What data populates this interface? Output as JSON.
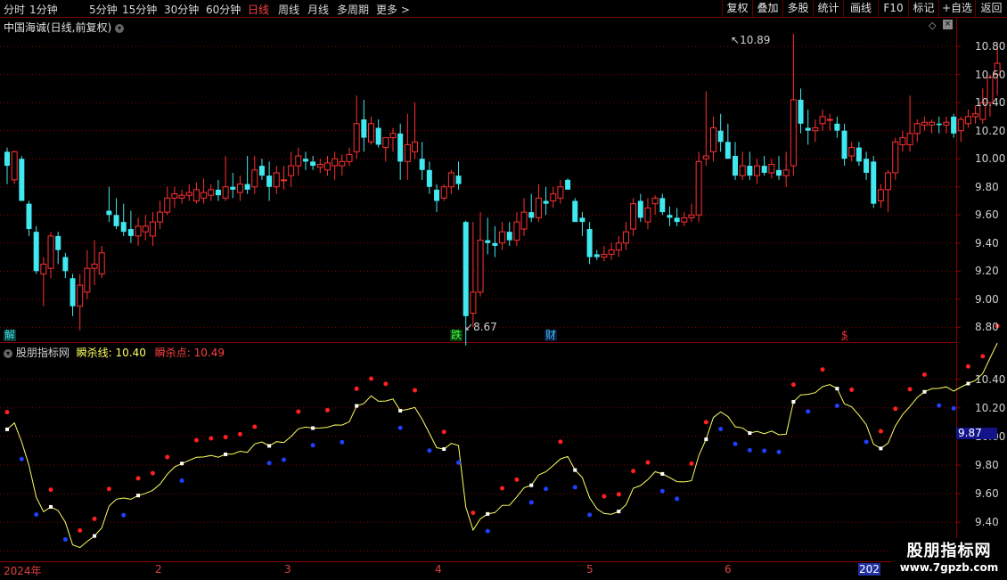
{
  "toolbar": {
    "periods": [
      "分时",
      "1分钟",
      "5分钟",
      "15分钟",
      "30分钟",
      "60分钟",
      "日线",
      "周线",
      "月线",
      "多周期",
      "更多 >"
    ],
    "active_period": "日线",
    "right_buttons": [
      "复权",
      "叠加",
      "多股",
      "统计",
      "画线",
      "F10",
      "标记",
      "+自选",
      "返回"
    ]
  },
  "stock": {
    "title": "中国海诚(日线,前复权)"
  },
  "main_axis": {
    "ticks": [
      "10.80",
      "10.60",
      "10.40",
      "10.20",
      "10.00",
      "9.80",
      "9.60",
      "9.40",
      "9.20",
      "9.00",
      "8.80"
    ],
    "ymin": 8.72,
    "ymax": 10.94
  },
  "annotations": {
    "high": "10.89",
    "low": "8.67"
  },
  "markers": [
    {
      "text": "解",
      "color": "#40e0e0",
      "bg": "#0a3a3a"
    },
    {
      "text": "跌",
      "color": "#40ff40",
      "bg": "#0a3a0a"
    },
    {
      "text": "财",
      "color": "#40c0ff",
      "bg": "#0a1a3a"
    },
    {
      "text": "$",
      "color": "#ff3030",
      "bg": "#000000"
    }
  ],
  "indicator": {
    "name": "股朋指标网",
    "line_label": "瞬杀线:",
    "line_value": "10.40",
    "point_label": "瞬杀点:",
    "point_value": "10.49",
    "ticks": [
      "10.40",
      "10.20",
      "10.00",
      "9.80",
      "9.60",
      "9.40",
      "9.20"
    ],
    "current": "9.87",
    "ymin": 9.14,
    "ymax": 10.56
  },
  "dates": [
    "2024年",
    "2",
    "3",
    "4",
    "5",
    "6",
    "202"
  ],
  "watermark": {
    "line1": "股朋指标网",
    "line2": "www.7gpzb.com"
  },
  "colors": {
    "up": "#ff3030",
    "down": "#40e8f0",
    "grid": "#8a0000",
    "line": "#ffff60",
    "red_dot": "#ff2020",
    "blue_dot": "#2040ff"
  },
  "chart_data": {
    "type": "candlestick",
    "series": [
      {
        "o": 10.05,
        "h": 10.08,
        "l": 9.82,
        "c": 9.95
      },
      {
        "o": 9.85,
        "h": 10.06,
        "l": 9.82,
        "c": 10.05
      },
      {
        "o": 10.0,
        "h": 10.02,
        "l": 9.75,
        "c": 9.7
      },
      {
        "o": 9.68,
        "h": 9.7,
        "l": 9.45,
        "c": 9.5
      },
      {
        "o": 9.48,
        "h": 9.52,
        "l": 9.18,
        "c": 9.2
      },
      {
        "o": 9.18,
        "h": 9.3,
        "l": 8.95,
        "c": 9.25
      },
      {
        "o": 9.22,
        "h": 9.48,
        "l": 9.15,
        "c": 9.45
      },
      {
        "o": 9.45,
        "h": 9.48,
        "l": 9.25,
        "c": 9.35
      },
      {
        "o": 9.3,
        "h": 9.33,
        "l": 9.15,
        "c": 9.2
      },
      {
        "o": 9.15,
        "h": 9.18,
        "l": 8.88,
        "c": 8.95
      },
      {
        "o": 8.95,
        "h": 9.18,
        "l": 8.78,
        "c": 9.1
      },
      {
        "o": 9.05,
        "h": 9.35,
        "l": 9.0,
        "c": 9.22
      },
      {
        "o": 9.22,
        "h": 9.42,
        "l": 9.1,
        "c": 9.25
      },
      {
        "o": 9.18,
        "h": 9.38,
        "l": 9.15,
        "c": 9.33
      },
      {
        "o": 9.63,
        "h": 9.8,
        "l": 9.55,
        "c": 9.6
      },
      {
        "o": 9.6,
        "h": 9.72,
        "l": 9.5,
        "c": 9.52
      },
      {
        "o": 9.55,
        "h": 9.68,
        "l": 9.45,
        "c": 9.48
      },
      {
        "o": 9.5,
        "h": 9.63,
        "l": 9.4,
        "c": 9.45
      },
      {
        "o": 9.45,
        "h": 9.58,
        "l": 9.38,
        "c": 9.52
      },
      {
        "o": 9.48,
        "h": 9.6,
        "l": 9.42,
        "c": 9.52
      },
      {
        "o": 9.45,
        "h": 9.62,
        "l": 9.38,
        "c": 9.55
      },
      {
        "o": 9.55,
        "h": 9.7,
        "l": 9.5,
        "c": 9.62
      },
      {
        "o": 9.62,
        "h": 9.8,
        "l": 9.6,
        "c": 9.72
      },
      {
        "o": 9.72,
        "h": 9.8,
        "l": 9.65,
        "c": 9.75
      },
      {
        "o": 9.72,
        "h": 9.78,
        "l": 9.68,
        "c": 9.74
      },
      {
        "o": 9.74,
        "h": 9.82,
        "l": 9.7,
        "c": 9.76
      },
      {
        "o": 9.7,
        "h": 9.83,
        "l": 9.68,
        "c": 9.78
      },
      {
        "o": 9.72,
        "h": 9.86,
        "l": 9.68,
        "c": 9.76
      },
      {
        "o": 9.74,
        "h": 9.82,
        "l": 9.7,
        "c": 9.78
      },
      {
        "o": 9.78,
        "h": 9.85,
        "l": 9.7,
        "c": 9.74
      },
      {
        "o": 9.72,
        "h": 10.02,
        "l": 9.7,
        "c": 9.8
      },
      {
        "o": 9.8,
        "h": 9.9,
        "l": 9.72,
        "c": 9.78
      },
      {
        "o": 9.76,
        "h": 9.88,
        "l": 9.7,
        "c": 9.82
      },
      {
        "o": 9.82,
        "h": 10.02,
        "l": 9.75,
        "c": 9.78
      },
      {
        "o": 9.8,
        "h": 10.02,
        "l": 9.75,
        "c": 9.92
      },
      {
        "o": 9.95,
        "h": 10.0,
        "l": 9.85,
        "c": 9.88
      },
      {
        "o": 9.88,
        "h": 9.98,
        "l": 9.7,
        "c": 9.8
      },
      {
        "o": 9.8,
        "h": 9.95,
        "l": 9.75,
        "c": 9.9
      },
      {
        "o": 9.85,
        "h": 9.95,
        "l": 9.78,
        "c": 9.85
      },
      {
        "o": 9.88,
        "h": 10.05,
        "l": 9.8,
        "c": 9.95
      },
      {
        "o": 9.95,
        "h": 10.08,
        "l": 9.88,
        "c": 10.02
      },
      {
        "o": 10.0,
        "h": 10.05,
        "l": 9.92,
        "c": 9.98
      },
      {
        "o": 9.98,
        "h": 10.02,
        "l": 9.92,
        "c": 9.95
      },
      {
        "o": 9.94,
        "h": 10.0,
        "l": 9.9,
        "c": 9.96
      },
      {
        "o": 9.92,
        "h": 10.02,
        "l": 9.88,
        "c": 9.97
      },
      {
        "o": 9.95,
        "h": 10.05,
        "l": 9.85,
        "c": 10.0
      },
      {
        "o": 9.95,
        "h": 10.03,
        "l": 9.88,
        "c": 9.98
      },
      {
        "o": 9.98,
        "h": 10.08,
        "l": 9.95,
        "c": 10.03
      },
      {
        "o": 10.05,
        "h": 10.45,
        "l": 10.0,
        "c": 10.25
      },
      {
        "o": 10.28,
        "h": 10.42,
        "l": 10.05,
        "c": 10.15
      },
      {
        "o": 10.12,
        "h": 10.3,
        "l": 10.1,
        "c": 10.25
      },
      {
        "o": 10.22,
        "h": 10.28,
        "l": 10.08,
        "c": 10.1
      },
      {
        "o": 10.08,
        "h": 10.12,
        "l": 9.98,
        "c": 10.15
      },
      {
        "o": 10.15,
        "h": 10.22,
        "l": 10.05,
        "c": 10.18
      },
      {
        "o": 10.18,
        "h": 10.25,
        "l": 9.85,
        "c": 9.98
      },
      {
        "o": 9.98,
        "h": 10.32,
        "l": 9.85,
        "c": 10.1
      },
      {
        "o": 10.05,
        "h": 10.4,
        "l": 10.0,
        "c": 10.12
      },
      {
        "o": 10.0,
        "h": 10.12,
        "l": 9.85,
        "c": 9.92
      },
      {
        "o": 9.92,
        "h": 9.98,
        "l": 9.75,
        "c": 9.8
      },
      {
        "o": 9.78,
        "h": 9.82,
        "l": 9.62,
        "c": 9.7
      },
      {
        "o": 9.72,
        "h": 9.82,
        "l": 9.7,
        "c": 9.8
      },
      {
        "o": 9.8,
        "h": 9.92,
        "l": 9.75,
        "c": 9.9
      },
      {
        "o": 9.88,
        "h": 9.98,
        "l": 9.78,
        "c": 9.82
      },
      {
        "o": 9.55,
        "h": 9.56,
        "l": 8.67,
        "c": 8.88
      },
      {
        "o": 8.9,
        "h": 9.55,
        "l": 8.8,
        "c": 9.05
      },
      {
        "o": 9.05,
        "h": 9.62,
        "l": 9.02,
        "c": 9.42
      },
      {
        "o": 9.42,
        "h": 9.58,
        "l": 9.32,
        "c": 9.4
      },
      {
        "o": 9.4,
        "h": 9.52,
        "l": 9.3,
        "c": 9.38
      },
      {
        "o": 9.4,
        "h": 9.55,
        "l": 9.35,
        "c": 9.48
      },
      {
        "o": 9.48,
        "h": 9.55,
        "l": 9.38,
        "c": 9.42
      },
      {
        "o": 9.42,
        "h": 9.62,
        "l": 9.38,
        "c": 9.55
      },
      {
        "o": 9.5,
        "h": 9.72,
        "l": 9.45,
        "c": 9.62
      },
      {
        "o": 9.62,
        "h": 9.75,
        "l": 9.55,
        "c": 9.58
      },
      {
        "o": 9.58,
        "h": 9.82,
        "l": 9.55,
        "c": 9.72
      },
      {
        "o": 9.7,
        "h": 9.8,
        "l": 9.6,
        "c": 9.68
      },
      {
        "o": 9.7,
        "h": 9.8,
        "l": 9.65,
        "c": 9.75
      },
      {
        "o": 9.72,
        "h": 9.85,
        "l": 9.68,
        "c": 9.8
      },
      {
        "o": 9.85,
        "h": 9.86,
        "l": 9.78,
        "c": 9.78
      },
      {
        "o": 9.7,
        "h": 9.72,
        "l": 9.55,
        "c": 9.55
      },
      {
        "o": 9.58,
        "h": 9.62,
        "l": 9.45,
        "c": 9.55
      },
      {
        "o": 9.5,
        "h": 9.55,
        "l": 9.25,
        "c": 9.3
      },
      {
        "o": 9.32,
        "h": 9.35,
        "l": 9.28,
        "c": 9.3
      },
      {
        "o": 9.3,
        "h": 9.38,
        "l": 9.27,
        "c": 9.32
      },
      {
        "o": 9.32,
        "h": 9.4,
        "l": 9.28,
        "c": 9.35
      },
      {
        "o": 9.35,
        "h": 9.45,
        "l": 9.3,
        "c": 9.4
      },
      {
        "o": 9.4,
        "h": 9.55,
        "l": 9.35,
        "c": 9.48
      },
      {
        "o": 9.5,
        "h": 9.72,
        "l": 9.45,
        "c": 9.68
      },
      {
        "o": 9.7,
        "h": 9.75,
        "l": 9.55,
        "c": 9.58
      },
      {
        "o": 9.55,
        "h": 9.72,
        "l": 9.5,
        "c": 9.65
      },
      {
        "o": 9.68,
        "h": 9.74,
        "l": 9.6,
        "c": 9.72
      },
      {
        "o": 9.72,
        "h": 9.75,
        "l": 9.6,
        "c": 9.62
      },
      {
        "o": 9.6,
        "h": 9.66,
        "l": 9.52,
        "c": 9.58
      },
      {
        "o": 9.58,
        "h": 9.65,
        "l": 9.52,
        "c": 9.55
      },
      {
        "o": 9.55,
        "h": 9.62,
        "l": 9.52,
        "c": 9.58
      },
      {
        "o": 9.58,
        "h": 9.68,
        "l": 9.55,
        "c": 9.6
      },
      {
        "o": 9.6,
        "h": 10.05,
        "l": 9.55,
        "c": 9.98
      },
      {
        "o": 10.0,
        "h": 10.48,
        "l": 9.95,
        "c": 10.02
      },
      {
        "o": 10.05,
        "h": 10.3,
        "l": 9.98,
        "c": 10.22
      },
      {
        "o": 10.2,
        "h": 10.32,
        "l": 10.05,
        "c": 10.12
      },
      {
        "o": 10.12,
        "h": 10.25,
        "l": 10.0,
        "c": 10.0
      },
      {
        "o": 10.02,
        "h": 10.12,
        "l": 9.85,
        "c": 9.88
      },
      {
        "o": 9.88,
        "h": 10.05,
        "l": 9.85,
        "c": 9.95
      },
      {
        "o": 9.95,
        "h": 10.05,
        "l": 9.85,
        "c": 9.88
      },
      {
        "o": 9.88,
        "h": 10.0,
        "l": 9.82,
        "c": 9.95
      },
      {
        "o": 9.95,
        "h": 10.02,
        "l": 9.88,
        "c": 9.9
      },
      {
        "o": 9.9,
        "h": 10.0,
        "l": 9.86,
        "c": 9.96
      },
      {
        "o": 9.92,
        "h": 10.02,
        "l": 9.85,
        "c": 9.88
      },
      {
        "o": 9.88,
        "h": 10.05,
        "l": 9.8,
        "c": 9.92
      },
      {
        "o": 9.95,
        "h": 10.89,
        "l": 9.88,
        "c": 10.42
      },
      {
        "o": 10.42,
        "h": 10.5,
        "l": 10.18,
        "c": 10.25
      },
      {
        "o": 10.22,
        "h": 10.35,
        "l": 10.1,
        "c": 10.2
      },
      {
        "o": 10.2,
        "h": 10.28,
        "l": 10.12,
        "c": 10.22
      },
      {
        "o": 10.25,
        "h": 10.35,
        "l": 10.2,
        "c": 10.3
      },
      {
        "o": 10.28,
        "h": 10.32,
        "l": 10.2,
        "c": 10.28
      },
      {
        "o": 10.25,
        "h": 10.3,
        "l": 10.15,
        "c": 10.2
      },
      {
        "o": 10.2,
        "h": 10.25,
        "l": 9.95,
        "c": 10.0
      },
      {
        "o": 10.02,
        "h": 10.12,
        "l": 9.98,
        "c": 10.08
      },
      {
        "o": 10.08,
        "h": 10.12,
        "l": 9.95,
        "c": 9.98
      },
      {
        "o": 10.0,
        "h": 10.05,
        "l": 9.85,
        "c": 9.9
      },
      {
        "o": 9.98,
        "h": 10.02,
        "l": 9.65,
        "c": 9.68
      },
      {
        "o": 9.7,
        "h": 9.82,
        "l": 9.65,
        "c": 9.78
      },
      {
        "o": 9.78,
        "h": 9.92,
        "l": 9.62,
        "c": 9.9
      },
      {
        "o": 9.9,
        "h": 10.15,
        "l": 9.85,
        "c": 10.12
      },
      {
        "o": 10.1,
        "h": 10.2,
        "l": 10.05,
        "c": 10.15
      },
      {
        "o": 10.1,
        "h": 10.45,
        "l": 10.05,
        "c": 10.18
      },
      {
        "o": 10.18,
        "h": 10.28,
        "l": 10.12,
        "c": 10.25
      },
      {
        "o": 10.24,
        "h": 10.3,
        "l": 10.2,
        "c": 10.26
      },
      {
        "o": 10.24,
        "h": 10.28,
        "l": 10.18,
        "c": 10.26
      },
      {
        "o": 10.25,
        "h": 10.3,
        "l": 10.18,
        "c": 10.24
      },
      {
        "o": 10.24,
        "h": 10.3,
        "l": 10.18,
        "c": 10.26
      },
      {
        "o": 10.3,
        "h": 10.32,
        "l": 10.15,
        "c": 10.18
      },
      {
        "o": 10.2,
        "h": 10.3,
        "l": 10.12,
        "c": 10.28
      },
      {
        "o": 10.25,
        "h": 10.35,
        "l": 10.22,
        "c": 10.3
      },
      {
        "o": 10.3,
        "h": 10.38,
        "l": 10.25,
        "c": 10.32
      },
      {
        "o": 10.28,
        "h": 10.5,
        "l": 10.25,
        "c": 10.4
      },
      {
        "o": 10.4,
        "h": 10.6,
        "l": 10.3,
        "c": 10.58
      },
      {
        "o": 10.6,
        "h": 10.82,
        "l": 10.45,
        "c": 10.68
      }
    ]
  }
}
